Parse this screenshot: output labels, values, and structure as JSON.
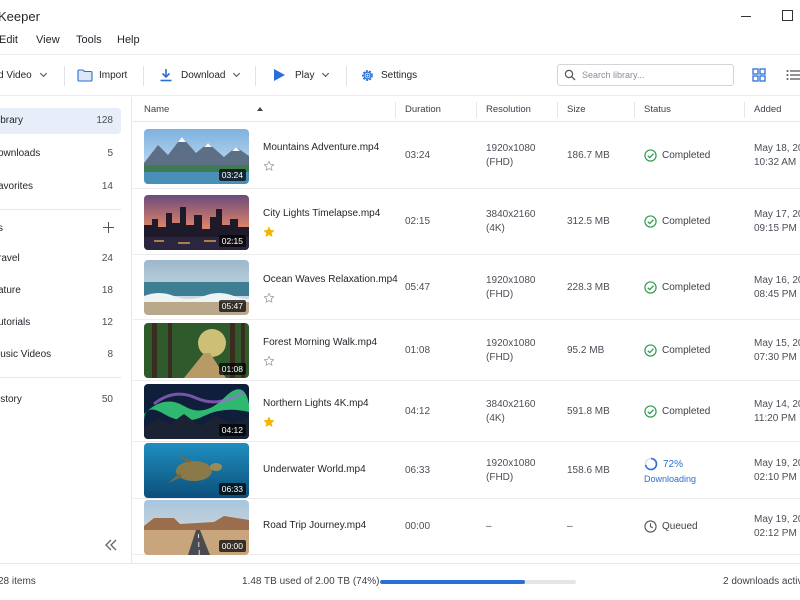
{
  "window": {
    "title": "Keeper"
  },
  "menu": [
    "Edit",
    "View",
    "Tools",
    "Help"
  ],
  "toolbar": {
    "add_video": "d Video",
    "import": "Import",
    "download": "Download",
    "play": "Play",
    "settings": "Settings"
  },
  "search": {
    "placeholder": "Search library..."
  },
  "sidebar": {
    "items": [
      {
        "label": "ibrary",
        "count": "128"
      },
      {
        "label": "ownloads",
        "count": "5"
      },
      {
        "label": "avorites",
        "count": "14"
      },
      {
        "label": "s",
        "count": ""
      },
      {
        "label": "ravel",
        "count": "24"
      },
      {
        "label": "ature",
        "count": "18"
      },
      {
        "label": "utorials",
        "count": "12"
      },
      {
        "label": "lusic Videos",
        "count": "8"
      },
      {
        "label": "istory",
        "count": "50"
      }
    ]
  },
  "columns": {
    "name": "Name",
    "duration": "Duration",
    "resolution": "Resolution",
    "size": "Size",
    "status": "Status",
    "added": "Added"
  },
  "rows": [
    {
      "name": "Mountains Adventure.mp4",
      "duration": "03:24",
      "res1": "1920x1080",
      "res2": "(FHD)",
      "size": "186.7 MB",
      "status": "Completed",
      "status_sub": "",
      "added1": "May 18, 20",
      "added2": "10:32 AM",
      "favorite": false,
      "state": "completed",
      "thumb": "mountains"
    },
    {
      "name": "City Lights Timelapse.mp4",
      "duration": "02:15",
      "res1": "3840x2160",
      "res2": "(4K)",
      "size": "312.5 MB",
      "status": "Completed",
      "status_sub": "",
      "added1": "May 17, 20",
      "added2": "09:15 PM",
      "favorite": true,
      "state": "completed",
      "thumb": "city"
    },
    {
      "name": "Ocean Waves Relaxation.mp4",
      "duration": "05:47",
      "res1": "1920x1080",
      "res2": "(FHD)",
      "size": "228.3 MB",
      "status": "Completed",
      "status_sub": "",
      "added1": "May 16, 20",
      "added2": "08:45 PM",
      "favorite": false,
      "state": "completed",
      "thumb": "ocean"
    },
    {
      "name": "Forest Morning Walk.mp4",
      "duration": "01:08",
      "res1": "1920x1080",
      "res2": "(FHD)",
      "size": "95.2 MB",
      "status": "Completed",
      "status_sub": "",
      "added1": "May 15, 20",
      "added2": "07:30 PM",
      "favorite": false,
      "state": "completed",
      "thumb": "forest"
    },
    {
      "name": "Northern Lights 4K.mp4",
      "duration": "04:12",
      "res1": "3840x2160",
      "res2": "(4K)",
      "size": "591.8 MB",
      "status": "Completed",
      "status_sub": "",
      "added1": "May 14, 20",
      "added2": "11:20 PM",
      "favorite": true,
      "state": "completed",
      "thumb": "aurora"
    },
    {
      "name": "Underwater World.mp4",
      "duration": "06:33",
      "res1": "1920x1080",
      "res2": "(FHD)",
      "size": "158.6 MB",
      "status": "72%",
      "status_sub": "Downloading",
      "progress": 0.72,
      "added1": "May 19, 20",
      "added2": "02:10 PM",
      "favorite": null,
      "state": "downloading",
      "thumb": "underwater"
    },
    {
      "name": "Road Trip Journey.mp4",
      "duration": "00:00",
      "res1": "–",
      "res2": "",
      "size": "–",
      "status": "Queued",
      "status_sub": "",
      "added1": "May 19, 20",
      "added2": "02:12 PM",
      "favorite": null,
      "state": "queued",
      "thumb": "road"
    }
  ],
  "footer": {
    "items": "28 items",
    "storage": "1.48 TB used of 2.00 TB (74%)",
    "storage_fraction": 0.74,
    "downloads": "2 downloads activ"
  },
  "colors": {
    "accent": "#2a6fd6",
    "completed": "#2e9d4f",
    "star": "#f4b400",
    "active_bg": "#e7eef9"
  }
}
